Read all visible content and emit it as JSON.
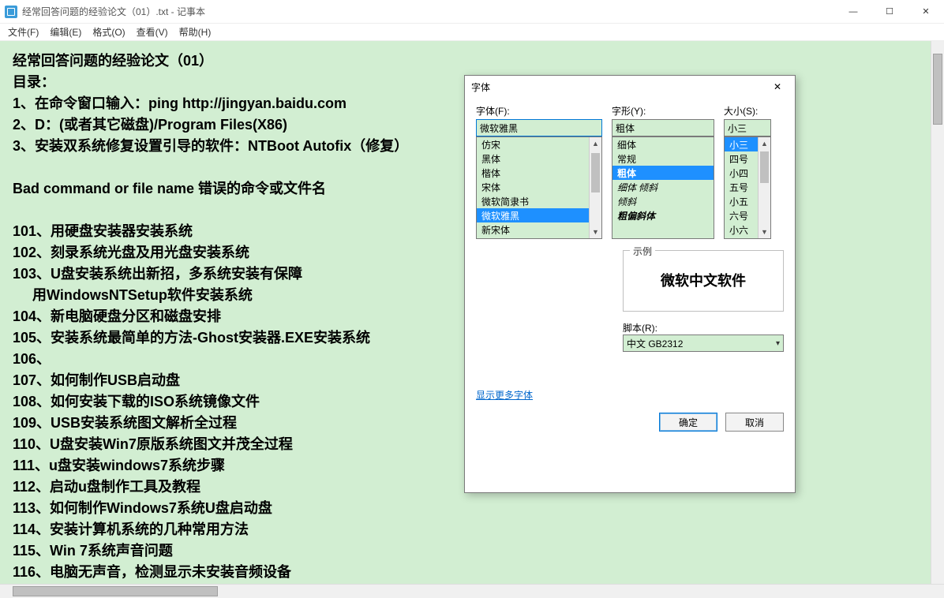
{
  "window": {
    "title": "经常回答问题的经验论文（01）.txt - 记事本"
  },
  "win_controls": {
    "min": "—",
    "max": "☐",
    "close": "✕"
  },
  "menu": {
    "file": "文件(F)",
    "edit": "编辑(E)",
    "format": "格式(O)",
    "view": "查看(V)",
    "help": "帮助(H)"
  },
  "doc_text": "经常回答问题的经验论文（01）\n目录：\n1、在命令窗口输入：ping http://jingyan.baidu.com\n2、D：(或者其它磁盘)/Program Files(X86)\n3、安装双系统修复设置引导的软件：NTBoot Autofix（修复）\n\nBad command or file name 错误的命令或文件名\n\n101、用硬盘安装器安装系统\n102、刻录系统光盘及用光盘安装系统\n103、U盘安装系统出新招，多系统安装有保障\n     用WindowsNTSetup软件安装系统\n104、新电脑硬盘分区和磁盘安排\n105、安装系统最简单的方法-Ghost安装器.EXE安装系统\n106、\n107、如何制作USB启动盘\n108、如何安装下载的ISO系统镜像文件\n109、USB安装系统图文解析全过程\n110、U盘安装Win7原版系统图文并茂全过程\n111、u盘安装windows7系统步骤\n112、启动u盘制作工具及教程\n113、如何制作Windows7系统U盘启动盘\n114、安装计算机系统的几种常用方法\n115、Win 7系统声音问题\n116、电脑无声音，检测显示未安装音频设备",
  "dialog": {
    "title": "字体",
    "close": "✕",
    "font_label": "字体(F):",
    "style_label": "字形(Y):",
    "size_label": "大小(S):",
    "font_value": "微软雅黑",
    "style_value": "粗体",
    "size_value": "小三",
    "font_list": [
      "仿宋",
      "黑体",
      "楷体",
      "宋体",
      "微软简隶书",
      "微软雅黑",
      "新宋体"
    ],
    "font_selected_index": 5,
    "style_list": [
      {
        "label": "细体",
        "bold": false,
        "italic": false
      },
      {
        "label": "常规",
        "bold": false,
        "italic": false
      },
      {
        "label": "粗体",
        "bold": true,
        "italic": false
      },
      {
        "label": "细体 倾斜",
        "bold": false,
        "italic": true
      },
      {
        "label": "倾斜",
        "bold": false,
        "italic": true
      },
      {
        "label": "粗偏斜体",
        "bold": true,
        "italic": true
      }
    ],
    "style_selected_index": 2,
    "size_list": [
      "小三",
      "四号",
      "小四",
      "五号",
      "小五",
      "六号",
      "小六"
    ],
    "size_selected_index": 0,
    "sample_legend": "示例",
    "sample_text": "微软中文软件",
    "script_label": "脚本(R):",
    "script_value": "中文 GB2312",
    "more_link": "显示更多字体",
    "ok": "确定",
    "cancel": "取消"
  }
}
